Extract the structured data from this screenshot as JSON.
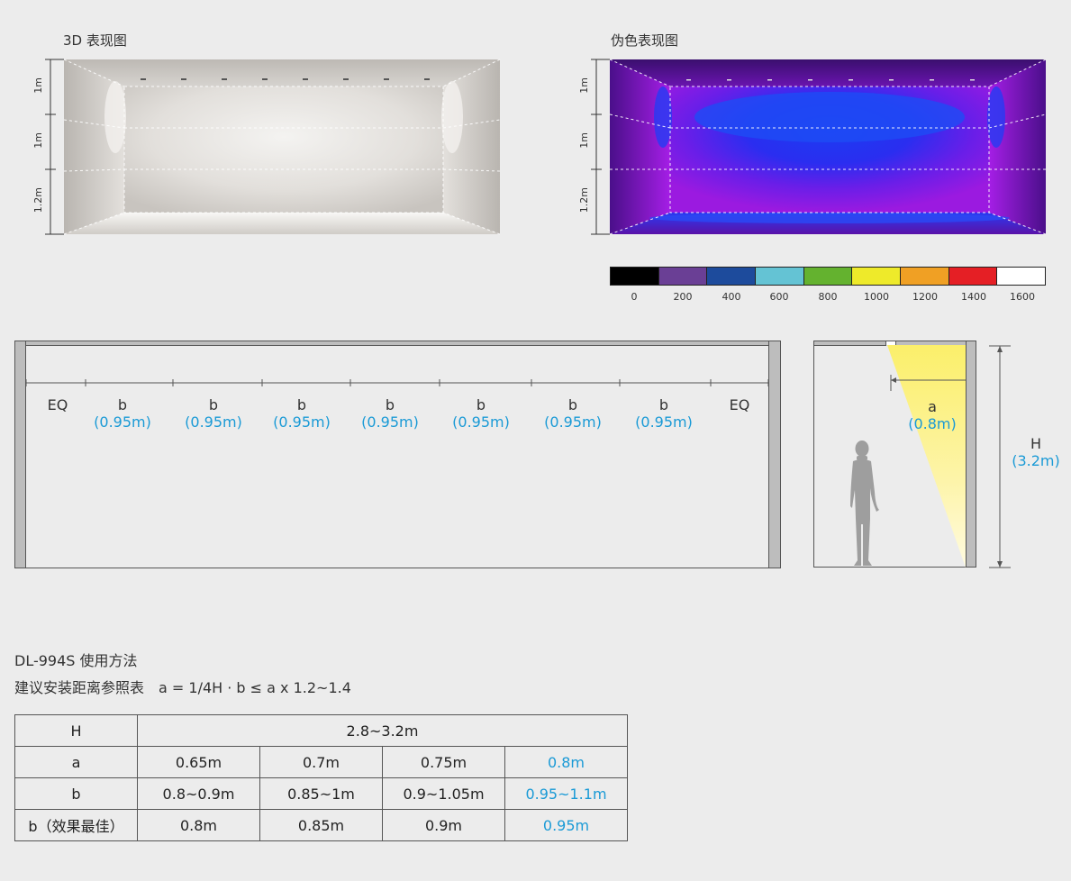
{
  "render3d": {
    "title": "3D 表现图",
    "dims": [
      "1m",
      "1m",
      "1.2m"
    ]
  },
  "falsecolor": {
    "title": "伪色表现图",
    "dims": [
      "1m",
      "1m",
      "1.2m"
    ]
  },
  "scale": {
    "colors": [
      "#000000",
      "#6a3f95",
      "#1d4b9c",
      "#64c3d4",
      "#64b22f",
      "#eeea2a",
      "#f0a024",
      "#e51f25",
      "#ffffff"
    ],
    "labels": [
      "0",
      "200",
      "400",
      "600",
      "800",
      "1000",
      "1200",
      "1400",
      "1600"
    ]
  },
  "plan": {
    "segments": [
      {
        "label": "EQ",
        "sub": ""
      },
      {
        "label": "b",
        "sub": "(0.95m)"
      },
      {
        "label": "b",
        "sub": "(0.95m)"
      },
      {
        "label": "b",
        "sub": "(0.95m)"
      },
      {
        "label": "b",
        "sub": "(0.95m)"
      },
      {
        "label": "b",
        "sub": "(0.95m)"
      },
      {
        "label": "b",
        "sub": "(0.95m)"
      },
      {
        "label": "b",
        "sub": "(0.95m)"
      },
      {
        "label": "EQ",
        "sub": ""
      }
    ]
  },
  "section": {
    "a_label": "a",
    "a_value": "(0.8m)",
    "h_label": "H",
    "h_value": "(3.2m)"
  },
  "usage": {
    "title": "DL-994S 使用方法",
    "formula": "建议安装距离参照表　a = 1/4H · b ≤ a x 1.2~1.4"
  },
  "table": {
    "h_row": {
      "head": "H",
      "value": "2.8~3.2m"
    },
    "rows": [
      {
        "head": "a",
        "cells": [
          "0.65m",
          "0.7m",
          "0.75m",
          "0.8m"
        ]
      },
      {
        "head": "b",
        "cells": [
          "0.8~0.9m",
          "0.85~1m",
          "0.9~1.05m",
          "0.95~1.1m"
        ]
      },
      {
        "head": "b（效果最佳）",
        "cells": [
          "0.8m",
          "0.85m",
          "0.9m",
          "0.95m"
        ]
      }
    ]
  }
}
